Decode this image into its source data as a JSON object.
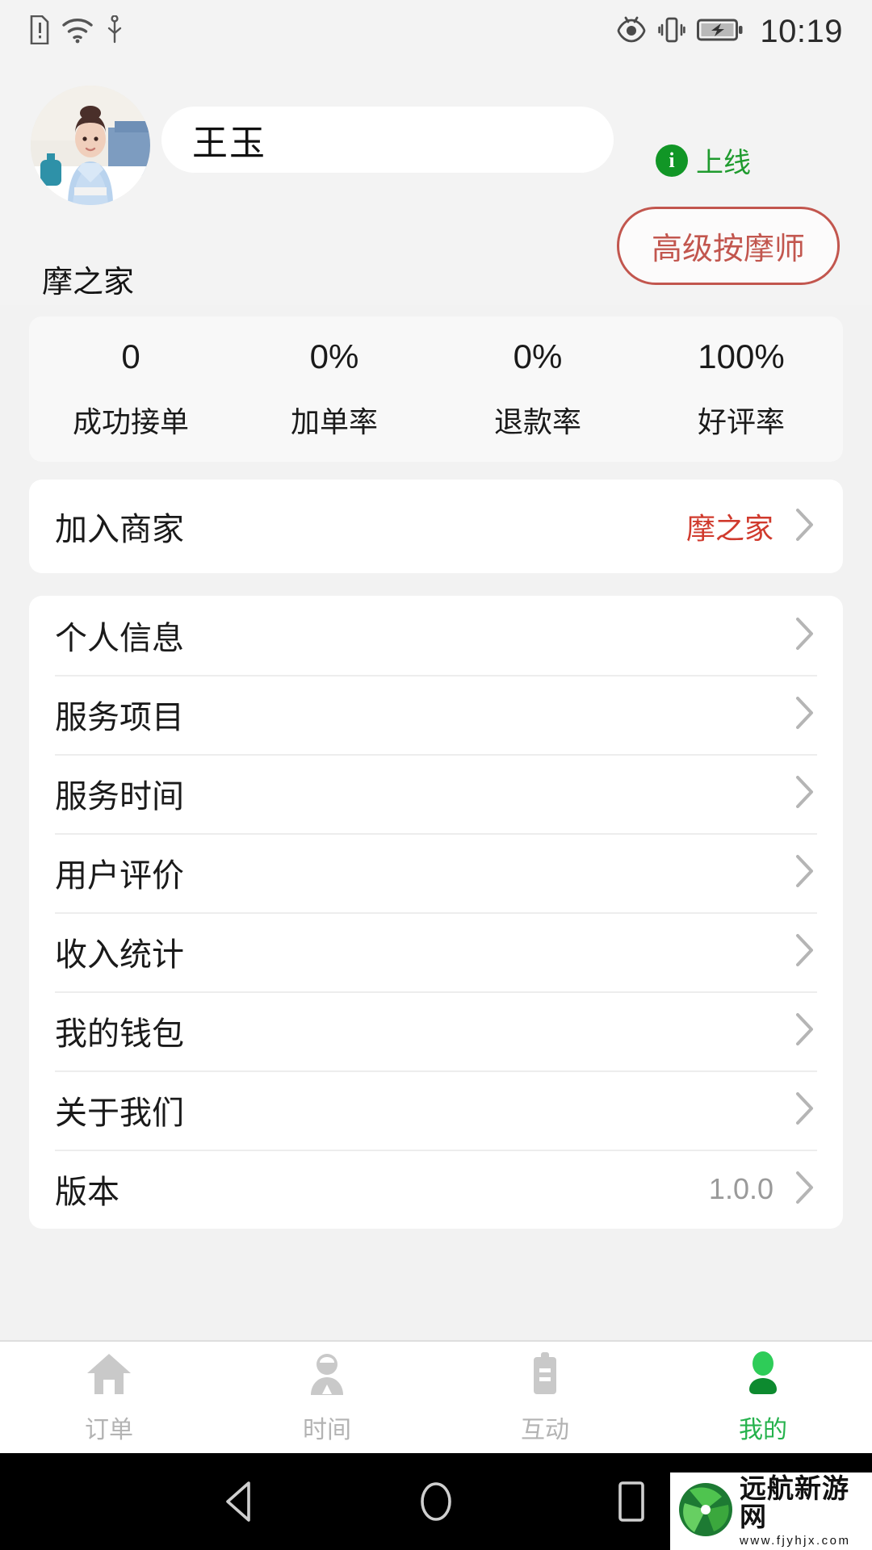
{
  "status_bar": {
    "time": "10:19",
    "left_icons": [
      "sim-alert-icon",
      "wifi-icon",
      "usb-icon"
    ],
    "right_icons": [
      "eye-comfort-icon",
      "vibrate-icon",
      "battery-charging-icon"
    ]
  },
  "profile": {
    "avatar": "therapist-avatar",
    "name": "王玉",
    "online_status": "上线",
    "online_icon": "info-circle-icon",
    "badge": "高级按摩师",
    "shop_name": "摩之家",
    "colors": {
      "online_green": "#1f9b2e",
      "badge_red": "#c2564e",
      "accent_red": "#d03a2d",
      "tab_active_green": "#25b24c"
    }
  },
  "stats": [
    {
      "value": "0",
      "label": "成功接单"
    },
    {
      "value": "0%",
      "label": "加单率"
    },
    {
      "value": "0%",
      "label": "退款率"
    },
    {
      "value": "100%",
      "label": "好评率"
    }
  ],
  "join_merchant": {
    "label": "加入商家",
    "value": "摩之家"
  },
  "menu": [
    {
      "label": "个人信息",
      "value": ""
    },
    {
      "label": "服务项目",
      "value": ""
    },
    {
      "label": "服务时间",
      "value": ""
    },
    {
      "label": "用户评价",
      "value": ""
    },
    {
      "label": "收入统计",
      "value": ""
    },
    {
      "label": "我的钱包",
      "value": ""
    },
    {
      "label": "关于我们",
      "value": ""
    },
    {
      "label": "版本",
      "value": "1.0.0"
    }
  ],
  "tabs": [
    {
      "label": "订单",
      "icon": "home-icon",
      "active": false
    },
    {
      "label": "时间",
      "icon": "person-icon",
      "active": false
    },
    {
      "label": "互动",
      "icon": "clipboard-icon",
      "active": false
    },
    {
      "label": "我的",
      "icon": "profile-icon",
      "active": true
    }
  ],
  "nav_bar": {
    "back": "back-triangle-icon",
    "home": "home-circle-icon",
    "recents": "recents-square-icon"
  },
  "watermark": {
    "title": "远航新游网",
    "url": "www.fjyhjx.com",
    "logo": "leaf-pinwheel-logo"
  }
}
